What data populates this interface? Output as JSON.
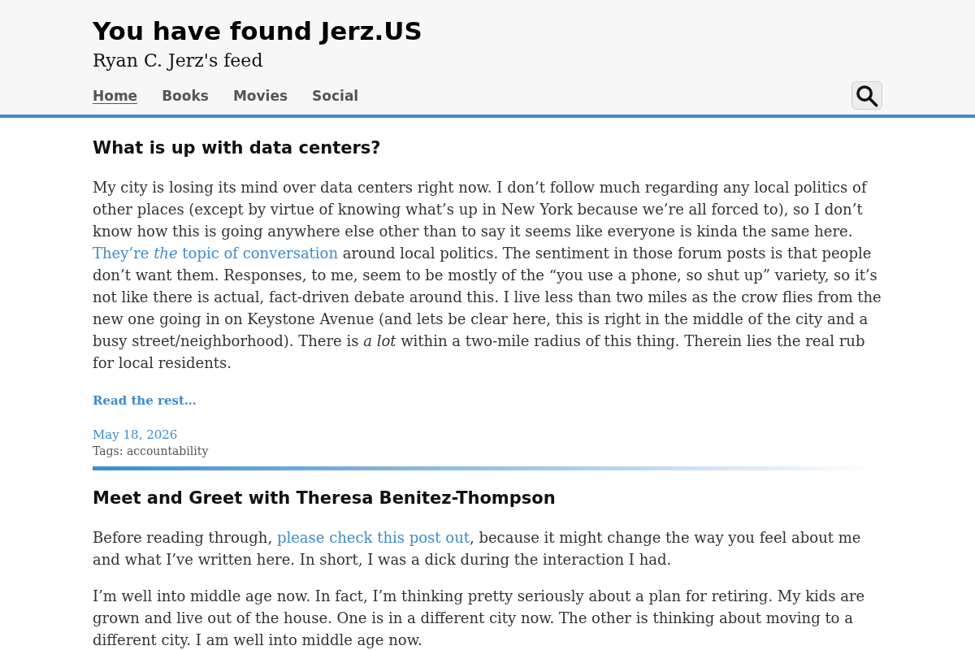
{
  "site": {
    "title": "You have found Jerz.US",
    "subtitle": "Ryan C. Jerz's feed"
  },
  "nav": {
    "items": [
      {
        "label": "Home",
        "selected": true
      },
      {
        "label": "Books",
        "selected": false
      },
      {
        "label": "Movies",
        "selected": false
      },
      {
        "label": "Social",
        "selected": false
      }
    ]
  },
  "posts": [
    {
      "title": "What is up with data centers?",
      "paragraphs": [
        [
          {
            "kind": "text",
            "text": "My city is losing its mind over data centers right now. I don’t follow much regarding any local politics of other places (except by virtue of knowing what’s up in New York because we’re all forced to), so I don’t know how this is going anywhere else other than to say it seems like everyone is kinda the same here. "
          },
          {
            "kind": "link",
            "text": "They’re *the* topic of conversation"
          },
          {
            "kind": "text",
            "text": " around local politics. The sentiment in those forum posts is that people don’t want them. Responses, to me, seem to be mostly of the “you use a phone, so shut up” variety, so it’s not like there is actual, fact-driven debate around this. I live less than two miles as the crow flies from the new one going in on Keystone Avenue (and lets be clear here, this is right in the middle of the city and a busy street/neighborhood). There is *a lot* within a two-mile radius of this thing. Therein lies the real rub for local residents."
          }
        ]
      ],
      "read_more": "Read the rest…",
      "date": "May 18, 2026",
      "tags": "Tags: accountability"
    },
    {
      "title": "Meet and Greet with Theresa Benitez-Thompson",
      "paragraphs": [
        [
          {
            "kind": "text",
            "text": "Before reading through, "
          },
          {
            "kind": "link",
            "text": "please check this post out"
          },
          {
            "kind": "text",
            "text": ", because it might change the way you feel about me and what I’ve written here. In short, I was a dick during the interaction I had."
          }
        ],
        [
          {
            "kind": "text",
            "text": "I’m well into middle age now. In fact, I’m thinking pretty seriously about a plan for retiring. My kids are grown and live out of the house. One is in a different city now. The other is thinking about moving to a different city. I am well into middle age now."
          }
        ]
      ]
    }
  ]
}
